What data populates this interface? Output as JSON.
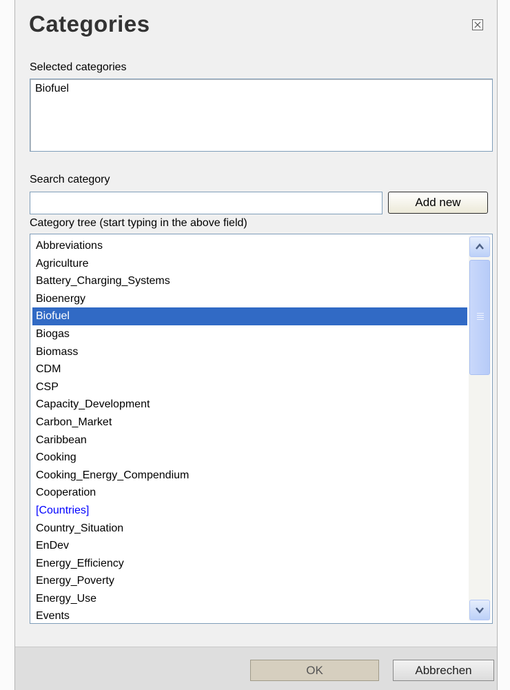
{
  "dialog": {
    "title": "Categories",
    "close_icon": "close-x-icon"
  },
  "selected": {
    "label": "Selected categories",
    "items": [
      "Biofuel"
    ]
  },
  "search": {
    "label": "Search category",
    "value": "",
    "placeholder": "",
    "add_label": "Add new"
  },
  "tree": {
    "label": "Category tree (start typing in the above field)",
    "selected_item": "Biofuel",
    "items": [
      "Abbreviations",
      "Agriculture",
      "Battery_Charging_Systems",
      "Bioenergy",
      "Biofuel",
      "Biogas",
      "Biomass",
      "CDM",
      "CSP",
      "Capacity_Development",
      "Carbon_Market",
      "Caribbean",
      "Cooking",
      "Cooking_Energy_Compendium",
      "Cooperation",
      "[Countries]",
      "Country_Situation",
      "EnDev",
      "Energy_Efficiency",
      "Energy_Poverty",
      "Energy_Use",
      "Events"
    ],
    "group_items": [
      "[Countries]"
    ],
    "scroll_up_icon": "chevron-up-icon",
    "scroll_down_icon": "chevron-down-icon"
  },
  "footer": {
    "ok_label": "OK",
    "cancel_label": "Abbrechen"
  },
  "colors": {
    "selection": "#316ac5",
    "group_link": "#0000ff",
    "field_border": "#7f9db9"
  }
}
